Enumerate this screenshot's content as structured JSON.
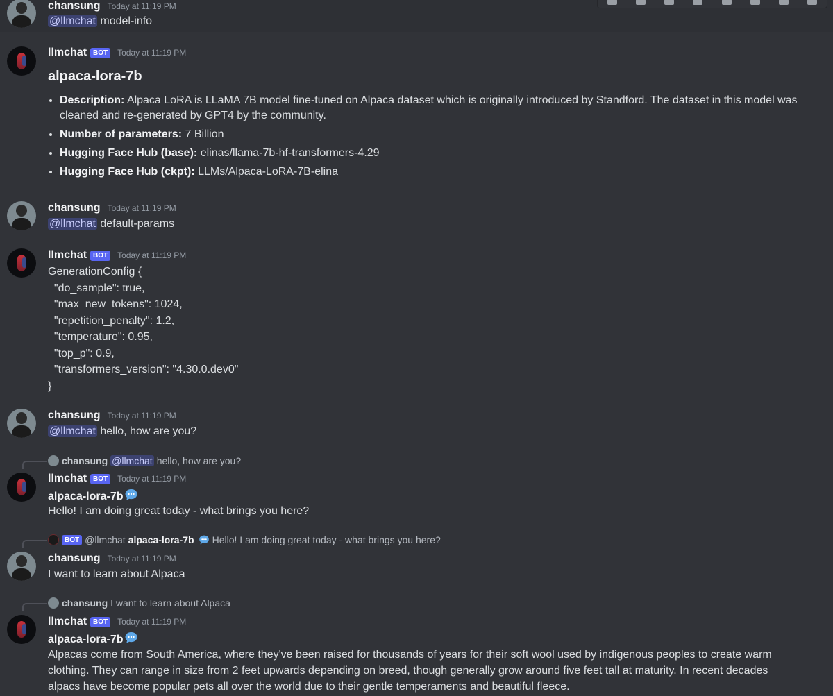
{
  "messages": [
    {
      "author": "chansung",
      "time": "Today at 11:19 PM",
      "mention": "@llmchat",
      "text": "model-info"
    },
    {
      "author": "llmchat",
      "bot_badge": "BOT",
      "time": "Today at 11:19 PM",
      "title": "alpaca-lora-7b",
      "facts": [
        {
          "label": "Description:",
          "value": "Alpaca LoRA is LLaMA 7B model fine-tuned on Alpaca dataset which is originally introduced by Standford. The dataset in this model was cleaned and re-generated by GPT4 by the community."
        },
        {
          "label": "Number of parameters:",
          "value": "7 Billion"
        },
        {
          "label": "Hugging Face Hub (base):",
          "value": "elinas/llama-7b-hf-transformers-4.29"
        },
        {
          "label": "Hugging Face Hub (ckpt):",
          "value": "LLMs/Alpaca-LoRA-7B-elina"
        }
      ]
    },
    {
      "author": "chansung",
      "time": "Today at 11:19 PM",
      "mention": "@llmchat",
      "text": "default-params"
    },
    {
      "author": "llmchat",
      "bot_badge": "BOT",
      "time": "Today at 11:19 PM",
      "code": [
        "GenerationConfig {",
        "  \"do_sample\": true,",
        "  \"max_new_tokens\": 1024,",
        "  \"repetition_penalty\": 1.2,",
        "  \"temperature\": 0.95,",
        "  \"top_p\": 0.9,",
        "  \"transformers_version\": \"4.30.0.dev0\"",
        "}"
      ]
    },
    {
      "author": "chansung",
      "time": "Today at 11:19 PM",
      "mention": "@llmchat",
      "text": "hello, how are you?"
    },
    {
      "reply": {
        "author": "chansung",
        "mention": "@llmchat",
        "text": "hello, how are you?"
      },
      "author": "llmchat",
      "bot_badge": "BOT",
      "time": "Today at 11:19 PM",
      "model": "alpaca-lora-7b",
      "text": "Hello! I am doing great today - what brings you here?"
    },
    {
      "reply": {
        "bot_badge": "BOT",
        "author": "@llmchat",
        "model": "alpaca-lora-7b",
        "text": "Hello! I am doing great today - what brings you here?"
      },
      "author": "chansung",
      "time": "Today at 11:19 PM",
      "text": "I want to learn about Alpaca"
    },
    {
      "reply": {
        "author": "chansung",
        "text": "I want to learn about Alpaca"
      },
      "author": "llmchat",
      "bot_badge": "BOT",
      "time": "Today at 11:19 PM",
      "model": "alpaca-lora-7b",
      "lines": [
        "Alpacas come from South America, where they've been raised for thousands of years for their soft wool used by indigenous peoples to create warm",
        "clothing. They can range in size from 2 feet upwards depending on breed, though generally grow around five feet tall at maturity. In recent decades",
        "alpacs have become popular pets all over the world due to their gentle temperaments and beautiful fleece."
      ]
    }
  ]
}
